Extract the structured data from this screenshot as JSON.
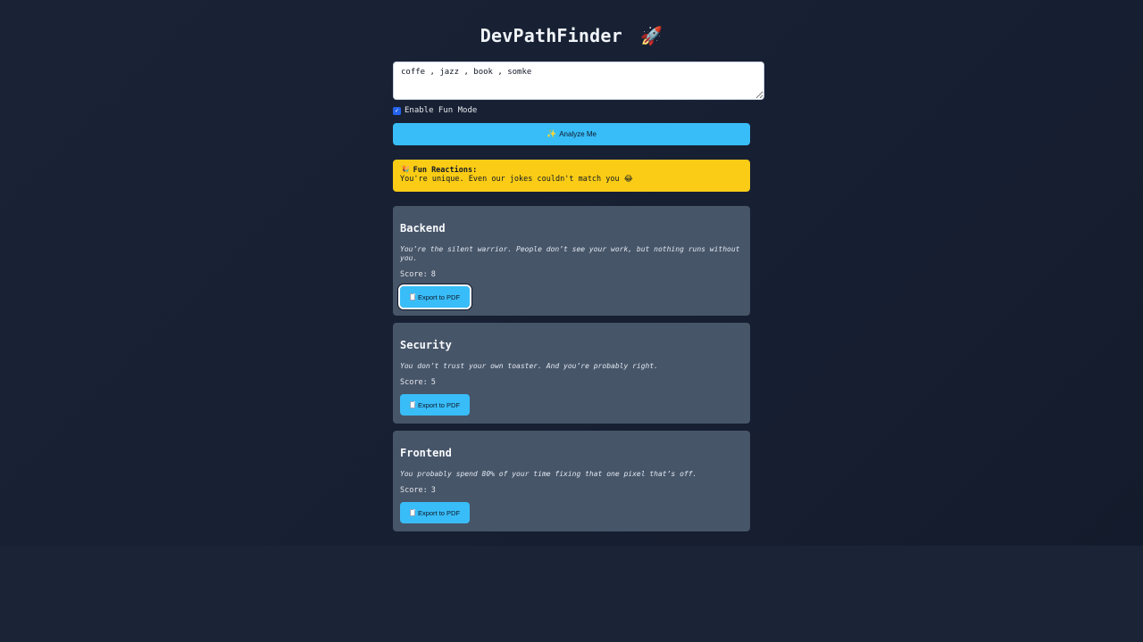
{
  "app": {
    "title": "DevPathFinder",
    "title_icon": "rocket-icon"
  },
  "input": {
    "value": "coffe , jazz , book , somke",
    "placeholder": ""
  },
  "fun_mode": {
    "label": "Enable Fun Mode",
    "checked": true
  },
  "analyze_button": {
    "label": "Analyze Me",
    "icon": "sparkles-icon"
  },
  "reactions": {
    "heading": "Fun Reactions:",
    "icon": "party-popper-icon",
    "text": "You're unique. Even our jokes couldn't match you",
    "text_emoji": "laughing-face-icon"
  },
  "results": [
    {
      "role": "Backend",
      "description": "You’re the silent warrior. People don’t see your work, but nothing runs without you.",
      "score_label": "Score:",
      "score": "8",
      "export_label": "Export to PDF"
    },
    {
      "role": "Security",
      "description": "You don’t trust your own toaster. And you’re probably right.",
      "score_label": "Score:",
      "score": "5",
      "export_label": "Export to PDF"
    },
    {
      "role": "Frontend",
      "description": "You probably spend 80% of your time fixing that one pixel that’s off.",
      "score_label": "Score:",
      "score": "3",
      "export_label": "Export to PDF"
    }
  ],
  "colors": {
    "background": "#1b2437",
    "accent": "#38bdf8",
    "reaction_bg": "#facc15",
    "card_bg": "#475569"
  }
}
